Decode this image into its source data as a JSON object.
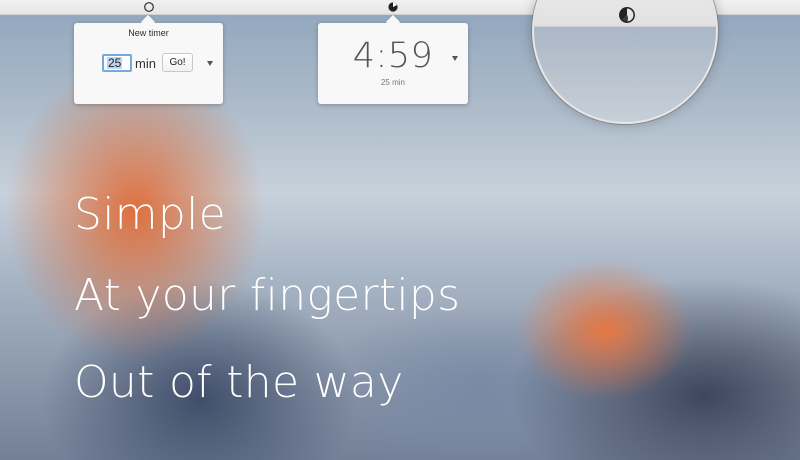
{
  "menu_bar": {
    "icons": [
      "empty-timer-icon",
      "active-timer-icon"
    ]
  },
  "new_timer_popover": {
    "title": "New timer",
    "minutes_value": "25",
    "unit_label": "min",
    "go_label": "Go!"
  },
  "running_timer_popover": {
    "time": "4:59",
    "duration_label": "25 min"
  },
  "magnifier": {
    "icon": "timer-progress-icon"
  },
  "hero": {
    "lines": [
      "Simple",
      "At your fingertips",
      "Out of the way"
    ]
  }
}
